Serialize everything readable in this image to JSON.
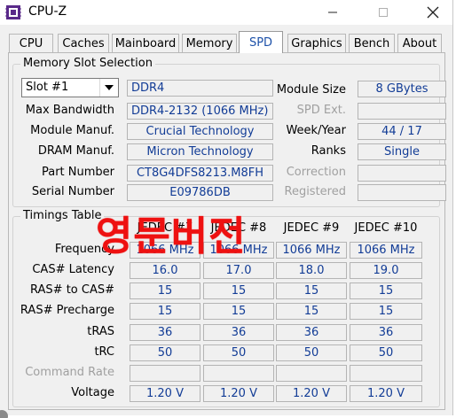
{
  "window": {
    "title": "CPU-Z"
  },
  "tabs": [
    "CPU",
    "Caches",
    "Mainboard",
    "Memory",
    "SPD",
    "Graphics",
    "Bench",
    "About"
  ],
  "active_tab": "SPD",
  "memory_slot": {
    "group_title": "Memory Slot Selection",
    "slot": "Slot #1",
    "type": "DDR4",
    "labels": {
      "max_bandwidth": "Max Bandwidth",
      "module_manuf": "Module Manuf.",
      "dram_manuf": "DRAM Manuf.",
      "part_number": "Part Number",
      "serial_number": "Serial Number",
      "module_size": "Module Size",
      "spd_ext": "SPD Ext.",
      "week_year": "Week/Year",
      "ranks": "Ranks",
      "correction": "Correction",
      "registered": "Registered"
    },
    "values": {
      "max_bandwidth": "DDR4-2132 (1066 MHz)",
      "module_manuf": "Crucial Technology",
      "dram_manuf": "Micron Technology",
      "part_number": "CT8G4DFS8213.M8FH",
      "serial_number": "E09786DB",
      "module_size": "8 GBytes",
      "spd_ext": "",
      "week_year": "44 / 17",
      "ranks": "Single",
      "correction": "",
      "registered": ""
    }
  },
  "timings": {
    "group_title": "Timings Table",
    "columns": [
      "JEDEC #7",
      "JEDEC #8",
      "JEDEC #9",
      "JEDEC #10"
    ],
    "rows": [
      {
        "label": "Frequency",
        "values": [
          "1066 MHz",
          "1066 MHz",
          "1066 MHz",
          "1066 MHz"
        ]
      },
      {
        "label": "CAS# Latency",
        "values": [
          "16.0",
          "17.0",
          "18.0",
          "19.0"
        ]
      },
      {
        "label": "RAS# to CAS#",
        "values": [
          "15",
          "15",
          "15",
          "15"
        ]
      },
      {
        "label": "RAS# Precharge",
        "values": [
          "15",
          "15",
          "15",
          "15"
        ]
      },
      {
        "label": "tRAS",
        "values": [
          "36",
          "36",
          "36",
          "36"
        ]
      },
      {
        "label": "tRC",
        "values": [
          "50",
          "50",
          "50",
          "50"
        ]
      },
      {
        "label": "Command Rate",
        "values": [
          "",
          "",
          "",
          ""
        ]
      },
      {
        "label": "Voltage",
        "values": [
          "1.20 V",
          "1.20 V",
          "1.20 V",
          "1.20 V"
        ]
      }
    ]
  },
  "overlay_text": "영문버전",
  "colors": {
    "value_text": "#123c96",
    "overlay": "#ee1111",
    "active_tab_text": "#1c50a8"
  }
}
